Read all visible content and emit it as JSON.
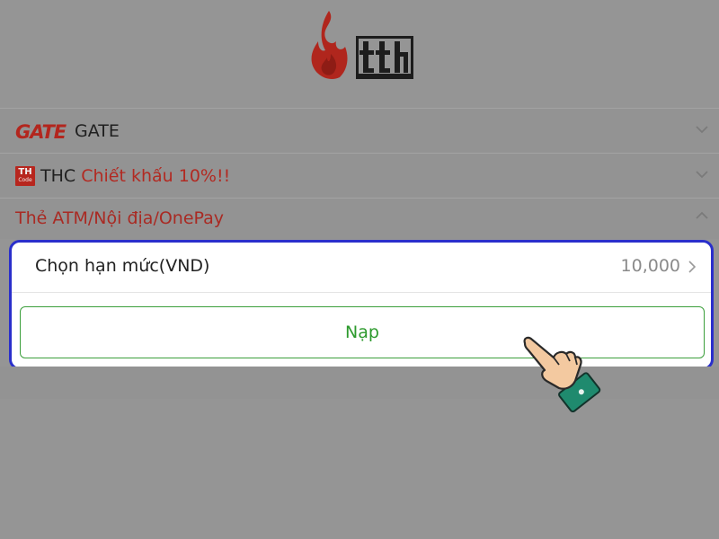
{
  "header": {
    "logo_name": "tth-fire-logo"
  },
  "payment_methods": {
    "gate": {
      "logo_text": "GATE",
      "label": "GATE"
    },
    "thc": {
      "logo_text": "TH",
      "logo_subtext": "Code",
      "name": "THC",
      "promo": "Chiết khấu 10%!!"
    },
    "atm": {
      "label": "Thẻ ATM/Nội địa/OnePay"
    }
  },
  "topup_panel": {
    "amount_label": "Chọn hạn mức(VND)",
    "amount_value": "10,000",
    "submit_label": "Nạp"
  },
  "colors": {
    "background": "#959595",
    "panel_border": "#2a2fcb",
    "submit_green": "#2d9a2d",
    "brand_red": "#b22a22"
  }
}
